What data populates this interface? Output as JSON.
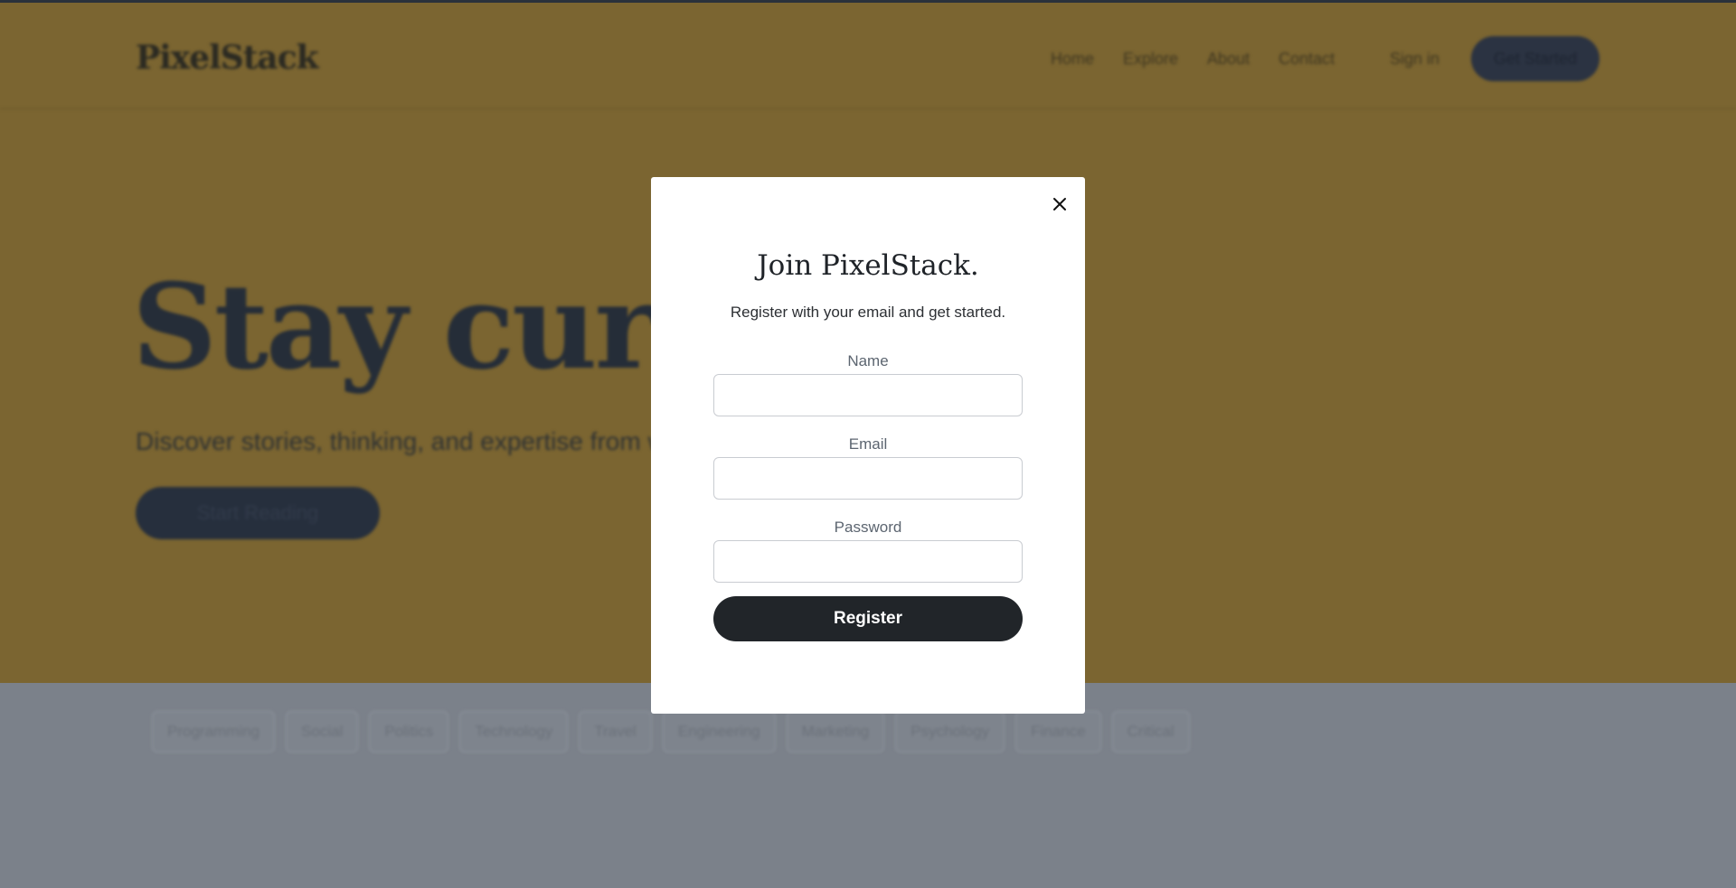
{
  "background": {
    "logo": "PixelStack",
    "nav_links": [
      "Home",
      "Explore",
      "About",
      "Contact"
    ],
    "sign_in": "Sign in",
    "get_started": "Get Started",
    "headline": "Stay curious.",
    "subline": "Discover stories, thinking, and expertise from writers on any topic.",
    "start_reading": "Start Reading",
    "tags": [
      "Programming",
      "Social",
      "Politics",
      "Technology",
      "Travel",
      "Engineering",
      "Marketing",
      "Psychology",
      "Finance",
      "Critical"
    ]
  },
  "modal": {
    "title": "Join PixelStack.",
    "subtitle": "Register with your email and get started.",
    "name_label": "Name",
    "email_label": "Email",
    "password_label": "Password",
    "name_value": "",
    "email_value": "",
    "password_value": "",
    "register_label": "Register",
    "close_icon": "close-icon"
  },
  "colors": {
    "hero_bg": "#7b6531",
    "page_bg": "#7b818a",
    "button_dark": "#212529",
    "modal_bg": "#ffffff"
  }
}
